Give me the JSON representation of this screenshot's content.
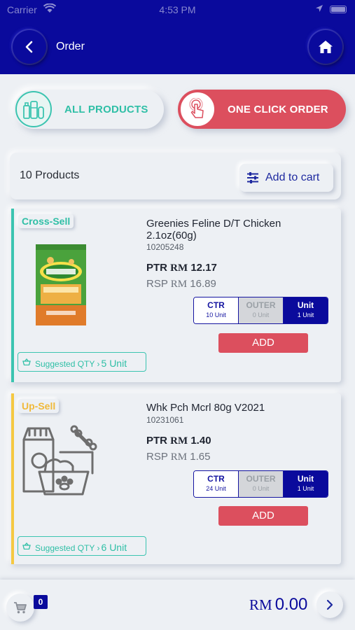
{
  "status_bar": {
    "carrier": "Carrier",
    "time": "4:53 PM"
  },
  "header": {
    "title": "Order"
  },
  "mode_toggle": {
    "all_products": "ALL PRODUCTS",
    "one_click_order": "ONE CLICK ORDER"
  },
  "product_list": {
    "count_label": "10 Products",
    "add_to_cart": "Add to cart"
  },
  "colors": {
    "brand": "#0a0a9c",
    "accent_red": "#dc4f5e",
    "accent_teal": "#2fbfa6",
    "upsell_yellow": "#f5c842"
  },
  "products": [
    {
      "tag": "Cross-Sell",
      "name": "Greenies Feline D/T Chicken 2.1oz(60g)",
      "sku": "10205248",
      "ptr_label": "PTR",
      "ptr_currency": "RM",
      "ptr_value": "12.17",
      "rsp_label": "RSP",
      "rsp_currency": "RM",
      "rsp_value": "16.89",
      "units": [
        {
          "title": "CTR",
          "sub": "10 Unit"
        },
        {
          "title": "OUTER",
          "sub": "0 Unit"
        },
        {
          "title": "Unit",
          "sub": "1 Unit"
        }
      ],
      "selected_unit": "Unit",
      "add_label": "ADD",
      "suggested_label": "Suggested QTY",
      "suggested_qty": "5 Unit",
      "image": "greenies-cat-treat-package"
    },
    {
      "tag": "Up-Sell",
      "name": "Whk Pch Mcrl 80g V2021",
      "sku": "10231061",
      "ptr_label": "PTR",
      "ptr_currency": "RM",
      "ptr_value": "1.40",
      "rsp_label": "RSP",
      "rsp_currency": "RM",
      "rsp_value": "1.65",
      "units": [
        {
          "title": "CTR",
          "sub": "24 Unit"
        },
        {
          "title": "OUTER",
          "sub": "0 Unit"
        },
        {
          "title": "Unit",
          "sub": "1 Unit"
        }
      ],
      "selected_unit": "Unit",
      "add_label": "ADD",
      "suggested_label": "Suggested QTY",
      "suggested_qty": "6 Unit",
      "image": "pet-food-placeholder-icon"
    }
  ],
  "footer": {
    "cart_count": "0",
    "total_currency": "RM",
    "total_value": "0.00"
  },
  "icons": [
    "back-icon",
    "home-icon",
    "products-icon",
    "touch-icon",
    "filter-icon",
    "basket-icon",
    "cart-icon",
    "chevron-right-icon"
  ]
}
